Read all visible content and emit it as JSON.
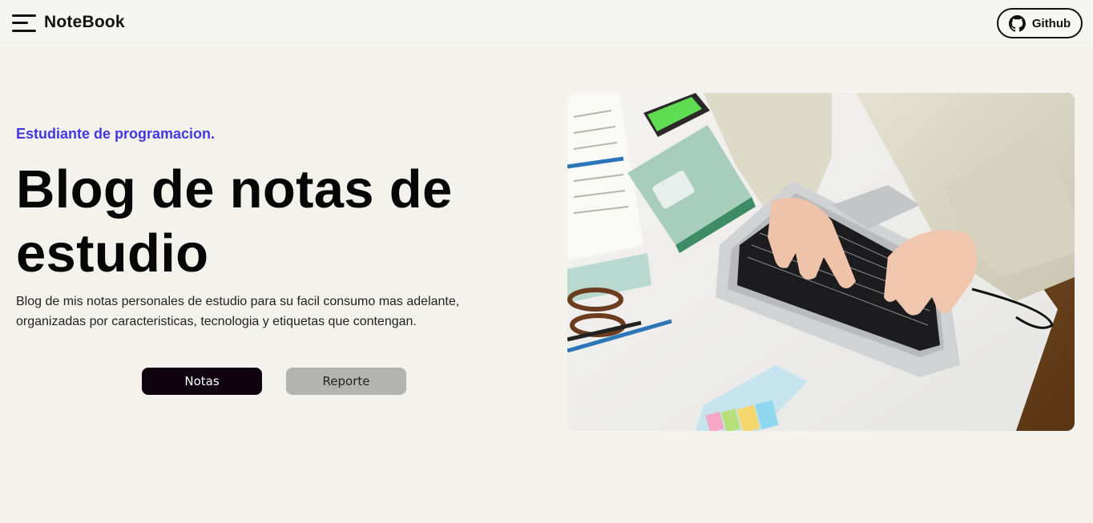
{
  "header": {
    "brand": "NoteBook",
    "github_label": "Github"
  },
  "hero": {
    "subtitle": "Estudiante de programacion.",
    "title": "Blog de notas de estudio",
    "description": "Blog de mis notas personales de estudio para su facil consumo mas adelante, organizadas por caracteristicas, tecnologia y etiquetas que contengan.",
    "buttons": {
      "notas": "Notas",
      "reporte": "Reporte"
    }
  },
  "colors": {
    "background": "#f3f2ec",
    "accent": "#4338e0",
    "primary_button": "#0f0310",
    "secondary_button": "#b3b3b1"
  },
  "icons": {
    "menu": "hamburger-menu-icon",
    "github": "github-icon"
  }
}
